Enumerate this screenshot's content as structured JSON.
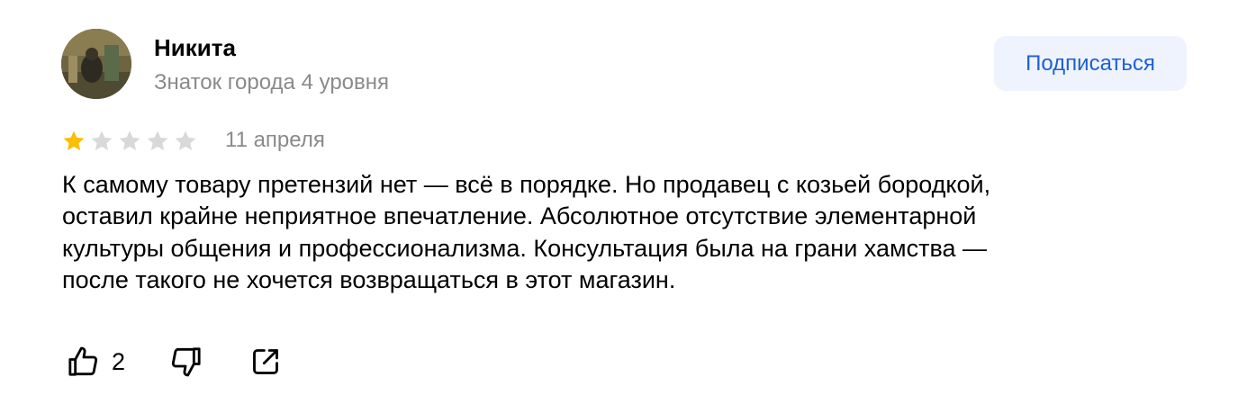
{
  "author": {
    "name": "Никита",
    "level": "Знаток города 4 уровня"
  },
  "subscribe_label": "Подписаться",
  "review": {
    "rating": 1,
    "rating_max": 5,
    "date": "11 апреля",
    "text_lines": [
      "К самому товару претензий нет — всё в порядке. Но продавец с козьей бородкой,",
      "оставил крайне неприятное впечатление. Абсолютное отсутствие элементарной",
      "культуры общения и профессионализма. Консультация была на грани хамства —",
      "после такого не хочется возвращаться в этот магазин."
    ]
  },
  "actions": {
    "like_count": "2",
    "like_icon": "thumbs-up-icon",
    "dislike_icon": "thumbs-down-icon",
    "share_icon": "share-icon"
  },
  "colors": {
    "star_filled": "#fcbe00",
    "star_empty": "#d9d9d9",
    "accent": "#1f5fd6",
    "button_bg": "#eef3fd",
    "secondary_text": "#8a8a8a"
  }
}
